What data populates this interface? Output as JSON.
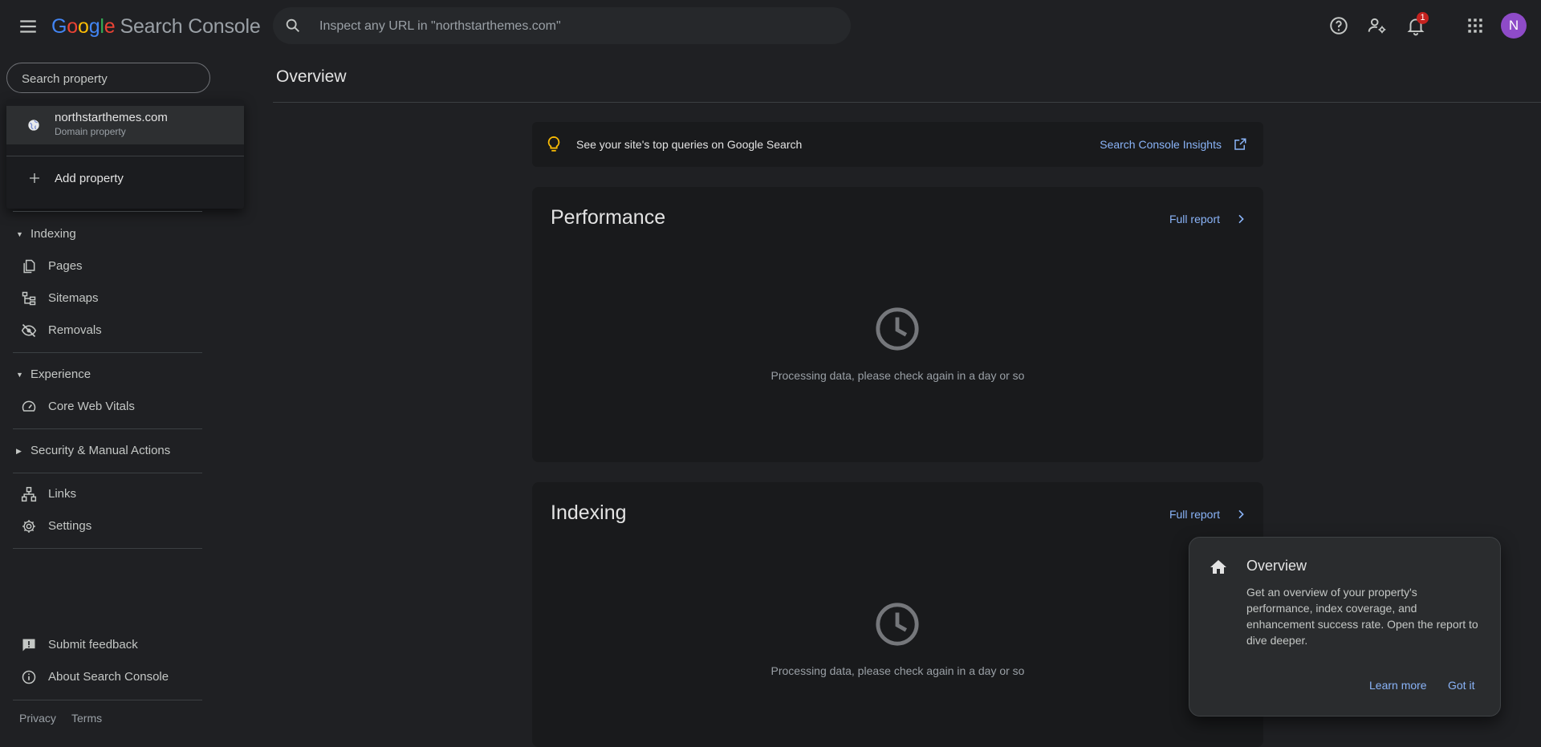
{
  "header": {
    "logo_google": [
      "G",
      "o",
      "o",
      "g",
      "l",
      "e"
    ],
    "logo_product": "Search Console",
    "search_placeholder": "Inspect any URL in \"northstarthemes.com\"",
    "notification_count": "1",
    "avatar_initial": "N",
    "icons": [
      "menu-icon",
      "search-icon",
      "help-icon",
      "manage-users-icon",
      "notifications-icon",
      "apps-grid-icon"
    ]
  },
  "sidebar": {
    "property_search_placeholder": "Search property",
    "property": {
      "name": "northstarthemes.com",
      "type": "Domain property"
    },
    "add_property": "Add property",
    "sections": {
      "indexing": "Indexing",
      "experience": "Experience",
      "security": "Security & Manual Actions"
    },
    "items": {
      "pages": "Pages",
      "sitemaps": "Sitemaps",
      "removals": "Removals",
      "core_web_vitals": "Core Web Vitals",
      "links": "Links",
      "settings": "Settings",
      "submit_feedback": "Submit feedback",
      "about": "About Search Console"
    },
    "footer": {
      "privacy": "Privacy",
      "terms": "Terms"
    }
  },
  "main": {
    "title": "Overview",
    "banner": {
      "text": "See your site's top queries on Google Search",
      "link": "Search Console Insights"
    },
    "cards": [
      {
        "title": "Performance",
        "link": "Full report",
        "message": "Processing data, please check again in a day or so"
      },
      {
        "title": "Indexing",
        "link": "Full report",
        "message": "Processing data, please check again in a day or so"
      }
    ]
  },
  "tooltip": {
    "title": "Overview",
    "body": "Get an overview of your property's performance, index coverage, and enhancement success rate. Open the report to dive deeper.",
    "learn_more": "Learn more",
    "got_it": "Got it"
  },
  "colors": {
    "background": "#1f2023",
    "card": "#191a1c",
    "link": "#8ab4f8",
    "bulb": "#fbbc04",
    "avatar": "#8e4bc8",
    "badge": "#c5221f"
  }
}
